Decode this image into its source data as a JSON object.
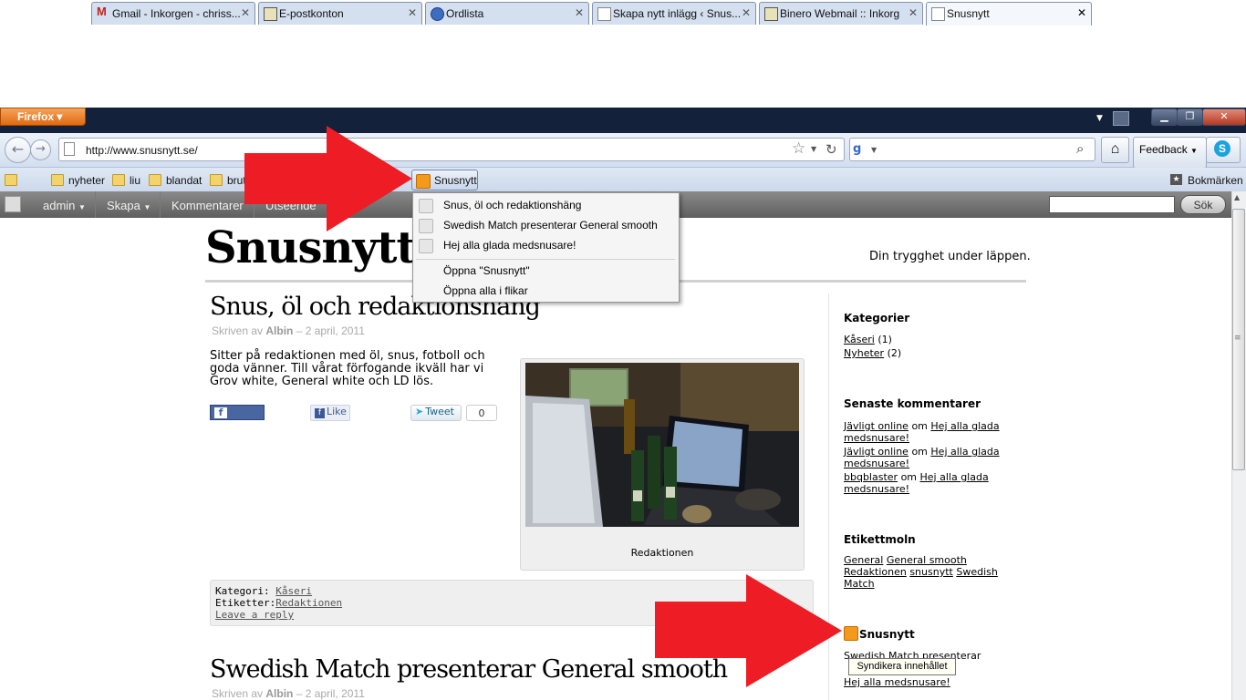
{
  "browser": {
    "menu_button": "Firefox",
    "tabs": [
      {
        "title": "Gmail - Inkorgen - chriss..."
      },
      {
        "title": "E-postkonton"
      },
      {
        "title": "Ordlista"
      },
      {
        "title": "Skapa nytt inlägg ‹ Snus..."
      },
      {
        "title": "Binero Webmail :: Inkorg"
      },
      {
        "title": "Snusnytt"
      }
    ],
    "url": "http://www.snusnytt.se/",
    "feedback_label": "Feedback",
    "bookmarks": [
      {
        "label": "nyheter"
      },
      {
        "label": "liu"
      },
      {
        "label": "blandat"
      },
      {
        "label": "brut"
      }
    ],
    "live_bookmark": "Snusnytt",
    "bookmarks_menu": "Bokmärken"
  },
  "livemark_menu": {
    "items": [
      "Snus, öl och redaktionshäng",
      "Swedish Match presenterar General smooth",
      "Hej alla glada medsnusare!"
    ],
    "open_label": "Öppna \"Snusnytt\"",
    "open_all_label": "Öppna alla i flikar"
  },
  "adminbar": {
    "user": "admin",
    "create": "Skapa",
    "comments": "Kommentarer",
    "partial": "Utseende",
    "search_button": "Sök"
  },
  "site": {
    "title": "Snusnytt",
    "tagline": "Din trygghet under läppen."
  },
  "post1": {
    "title": "Snus, öl och redaktionshäng",
    "meta_prefix": "Skriven av",
    "author": "Albin",
    "date": "– 2 april, 2011",
    "body": "Sitter på redaktionen med öl, snus, fotboll och goda vänner. Till vårat förfogande ikväll har vi Grov white, General white och LD lös.",
    "share": "Share",
    "like": "Like",
    "tweet": "Tweet",
    "tweet_count": "0",
    "caption": "Redaktionen",
    "category_label": "Kategori:",
    "category": "Kåseri",
    "tags_label": "Etiketter:",
    "tags": "Redaktionen",
    "reply": "Leave a reply"
  },
  "post2": {
    "title": "Swedish Match presenterar General smooth",
    "meta_prefix": "Skriven av",
    "author": "Albin",
    "date": "– 2 april, 2011"
  },
  "sidebar": {
    "categories_title": "Kategorier",
    "categories": [
      {
        "name": "Kåseri",
        "count": "(1)"
      },
      {
        "name": "Nyheter",
        "count": "(2)"
      }
    ],
    "comments_title": "Senaste kommentarer",
    "comments": [
      {
        "author": "Jävligt online",
        "on": "om",
        "post": "Hej alla glada medsnusare!"
      },
      {
        "author": "Jävligt online",
        "on": "om",
        "post": "Hej alla glada medsnusare!"
      },
      {
        "author": "bbqblaster",
        "on": "om",
        "post": "Hej alla glada medsnusare!"
      }
    ],
    "tags_title": "Etikettmoln",
    "tags": [
      "General",
      "General smooth",
      "Redaktionen",
      "snusnytt",
      "Swedish Match"
    ],
    "rss_title": "Snusnytt",
    "rss_link1": "Swedish Match presenterar",
    "rss_link3": "Hej alla medsnusare!",
    "tooltip": "Syndikera innehållet"
  },
  "colors": {
    "annotation_arrow": "#ee1c24",
    "admin_bar": "#6e6e6e",
    "rss_orange": "#f39a1d"
  }
}
